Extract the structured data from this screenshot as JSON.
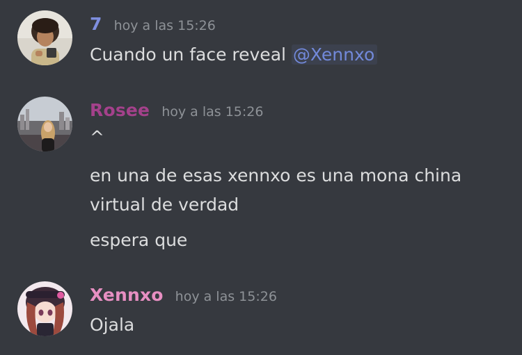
{
  "theme": {
    "background": "#36393f",
    "text": "#dcddde",
    "muted": "#8e9297",
    "mention_color": "#7289da"
  },
  "messages": [
    {
      "author": "7",
      "author_color": "#7f8fe0",
      "timestamp": "hoy a las 15:26",
      "avatar": "avatar-photo-man-curly-hair",
      "lines": [
        "Cuando un face reveal"
      ],
      "mention": "@Xennxo"
    },
    {
      "author": "Rosee",
      "author_color": "#a4418b",
      "timestamp": "hoy a las 15:26",
      "avatar": "avatar-photo-woman-city",
      "lines": [
        "^",
        "en una de esas xennxo es una mona china",
        "virtual de verdad",
        "espera que"
      ]
    },
    {
      "author": "Xennxo",
      "author_color": "#e78fc2",
      "timestamp": "hoy a las 15:26",
      "avatar": "avatar-anime-girl",
      "lines": [
        "Ojala"
      ]
    }
  ]
}
